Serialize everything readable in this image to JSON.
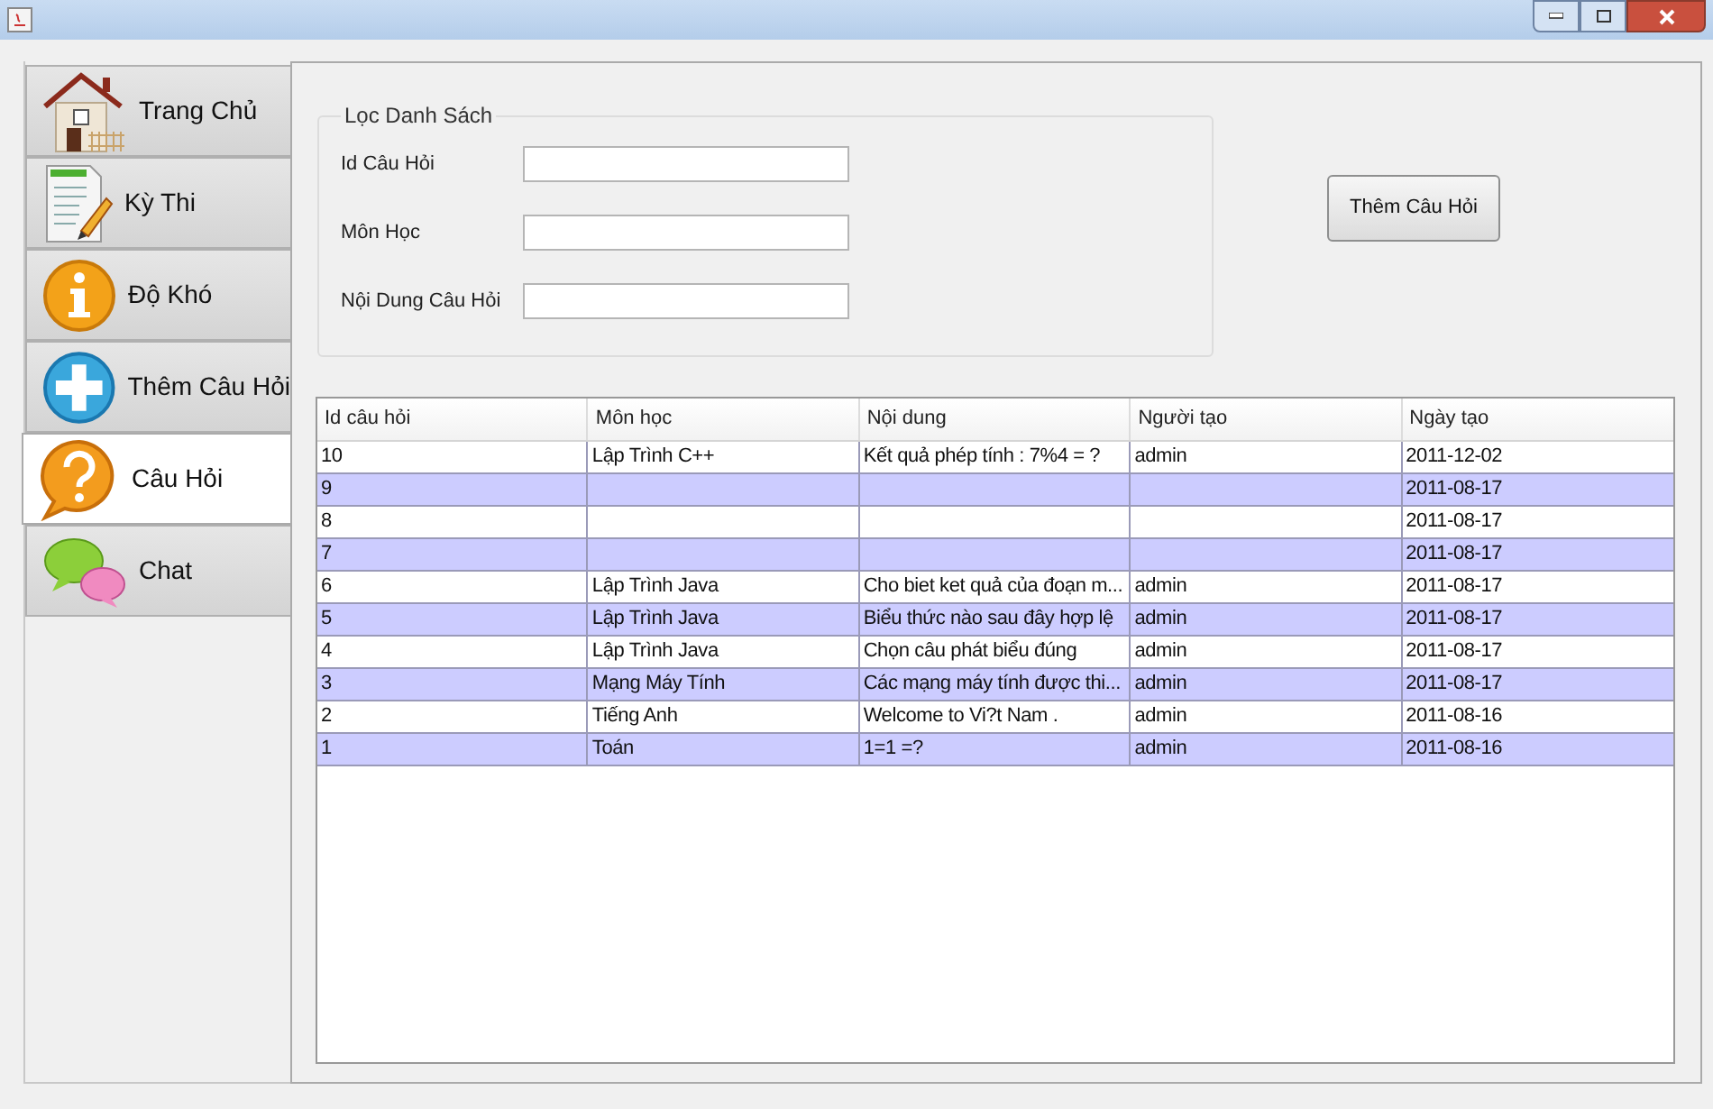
{
  "tabs": [
    {
      "label": "Trang Chủ",
      "kind": "home",
      "selected": false
    },
    {
      "label": "Kỳ Thi",
      "kind": "document",
      "selected": false
    },
    {
      "label": "Độ Khó",
      "kind": "info",
      "selected": false
    },
    {
      "label": "Thêm Câu Hỏi",
      "kind": "add",
      "selected": false
    },
    {
      "label": "Câu Hỏi",
      "kind": "help",
      "selected": true
    },
    {
      "label": "Chat",
      "kind": "chat",
      "selected": false
    }
  ],
  "filter": {
    "title": "Lọc Danh Sách",
    "fields": [
      {
        "label": "Id Câu Hỏi"
      },
      {
        "label": "Môn Học"
      },
      {
        "label": "Nội Dung Câu Hỏi"
      }
    ]
  },
  "add_button": "Thêm Câu Hỏi",
  "table": {
    "columns": [
      "Id câu hỏi",
      "Môn học",
      "Nội dung",
      "Người tạo",
      "Ngày tạo"
    ],
    "rows": [
      [
        "10",
        "Lập Trình C++",
        "Kết quả phép tính : 7%4 = ?",
        "admin",
        "2011-12-02"
      ],
      [
        "9",
        null,
        null,
        null,
        "2011-08-17"
      ],
      [
        "8",
        null,
        null,
        null,
        "2011-08-17"
      ],
      [
        "7",
        null,
        null,
        null,
        "2011-08-17"
      ],
      [
        "6",
        "Lập Trình Java",
        "Cho biet ket quả của đoạn m...",
        "admin",
        "2011-08-17"
      ],
      [
        "5",
        "Lập Trình Java",
        "Biểu thức nào sau đây hợp lệ",
        "admin",
        "2011-08-17"
      ],
      [
        "4",
        "Lập Trình Java",
        "Chọn câu phát biểu đúng",
        "admin",
        "2011-08-17"
      ],
      [
        "3",
        "Mạng Máy Tính",
        "Các mạng máy tính được thi...",
        "admin",
        "2011-08-17"
      ],
      [
        "2",
        "Tiếng Anh",
        "Welcome to Vi?t Nam .",
        "admin",
        "2011-08-16"
      ],
      [
        "1",
        "Toán",
        "1=1 =?",
        "admin",
        "2011-08-16"
      ]
    ]
  }
}
